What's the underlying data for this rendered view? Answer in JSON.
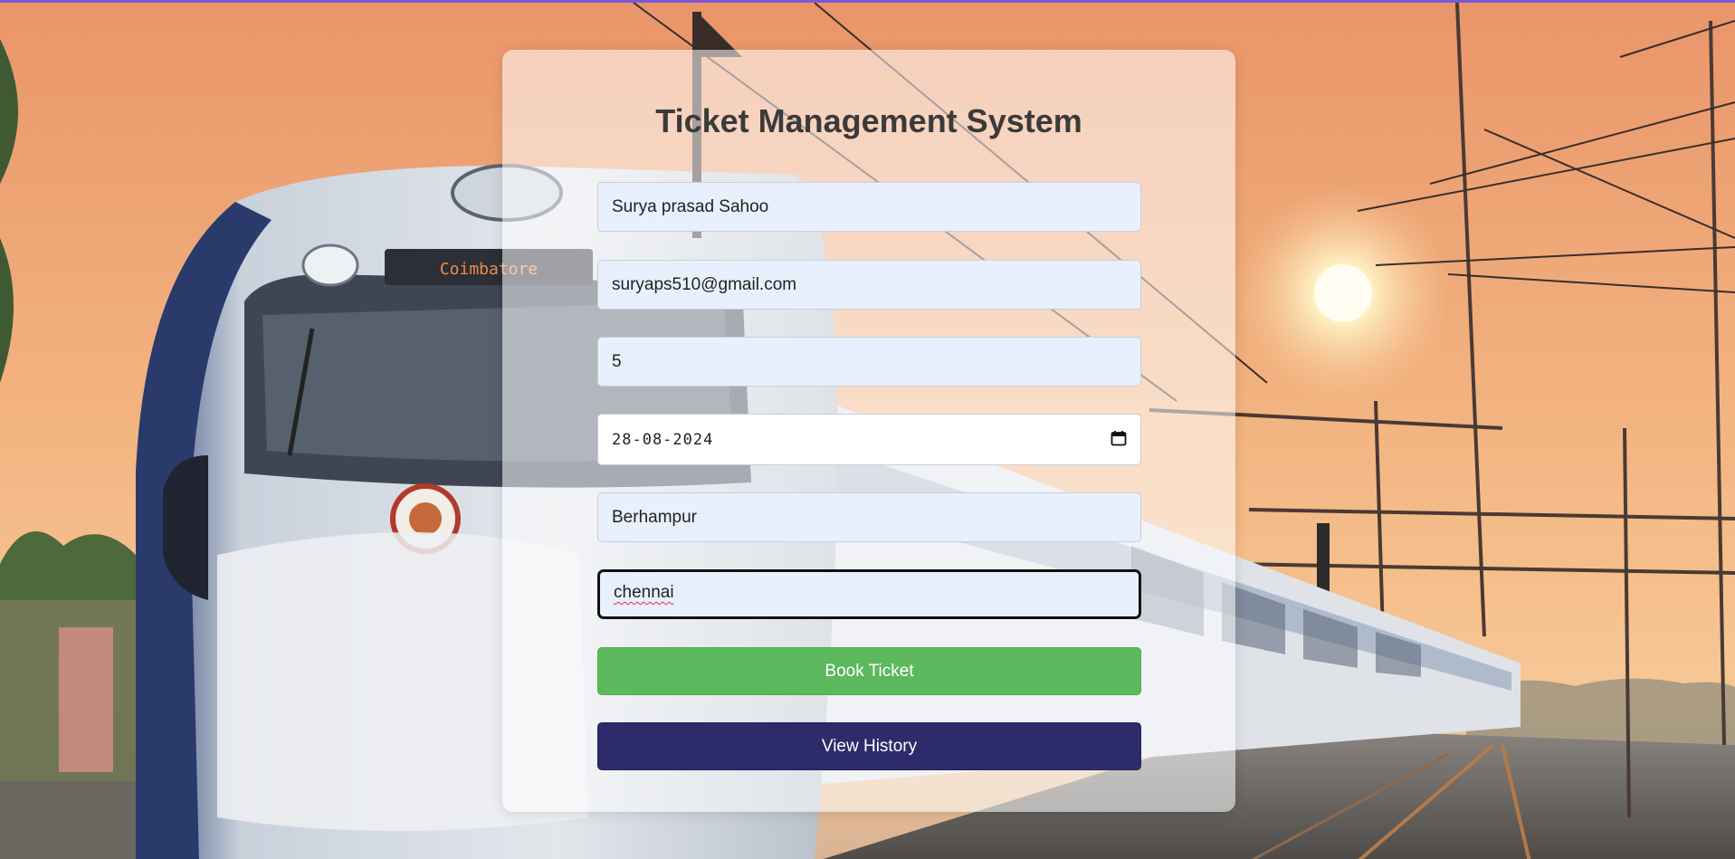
{
  "page": {
    "title": "Ticket Management System"
  },
  "form": {
    "name_value": "Surya prasad Sahoo",
    "email_value": "suryaps510@gmail.com",
    "tickets_value": "5",
    "date_value": "28-08-2024",
    "from_value": "Berhampur",
    "to_value": "chennai",
    "book_label": "Book Ticket",
    "history_label": "View History"
  },
  "background": {
    "train_display": "Coimbatore"
  },
  "colors": {
    "book_button": "#5cb85c",
    "history_button": "#2e2b6b",
    "input_fill": "#e8f0fe",
    "top_border": "#7b58d6"
  }
}
